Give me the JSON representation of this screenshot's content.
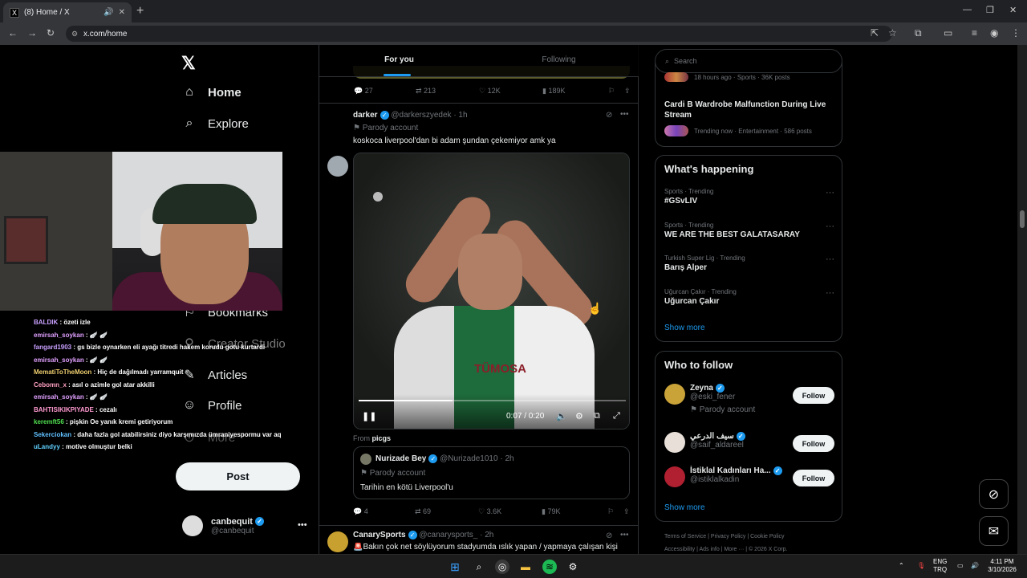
{
  "browser": {
    "tab_title": "(8) Home / X",
    "tab_favicon": "X",
    "url": "x.com/home"
  },
  "nav": {
    "home": "Home",
    "explore": "Explore",
    "bookmarks": "Bookmarks",
    "creator_studio": "Creator Studio",
    "articles": "Articles",
    "profile": "Profile",
    "more": "More",
    "post_button": "Post",
    "notif_badge": "8"
  },
  "account": {
    "name": "canbequit",
    "handle": "@canbequit"
  },
  "chat": [
    {
      "user": "BALDIK",
      "color": "#c9a0ff",
      "msg": ": özeti izle"
    },
    {
      "user": "emirsah_soykan",
      "color": "#e0a0ff",
      "msg": ": 🪽 🪽"
    },
    {
      "user": "fangard1903",
      "color": "#c9a0ff",
      "msg": ": gs bizle oynarken eli ayağı titredi hakem korudu gotu kurtardi"
    },
    {
      "user": "emirsah_soykan",
      "color": "#e0a0ff",
      "msg": ": 🪽 🪽"
    },
    {
      "user": "MematiToTheMoon",
      "color": "#f0d070",
      "msg": ": Hiç de dağılmadı yarramquit"
    },
    {
      "user": "Cebomn_x",
      "color": "#ffa0c0",
      "msg": ": asıl o azimle gol atar akkilli"
    },
    {
      "user": "emirsah_soykan",
      "color": "#e0a0ff",
      "msg": ": 🪽 🪽"
    },
    {
      "user": "BAHTISIKIKPIYADE",
      "color": "#ff9ad0",
      "msg": ": cezalı"
    },
    {
      "user": "keremft56",
      "color": "#50e050",
      "msg": ": pişkin Oe yanık kremi getiriyorum"
    },
    {
      "user": "Sekerciokan",
      "color": "#60c0ff",
      "msg": ": daha fazla gol atabilirsiniz diyo karşımızda ümraniyespormu var aq"
    },
    {
      "user": "uLandyy",
      "color": "#60d0ff",
      "msg": ": motive olmuştur belki"
    }
  ],
  "feed": {
    "tab_for_you": "For you",
    "tab_following": "Following",
    "top_stats": {
      "replies": "27",
      "reposts": "213",
      "likes": "12K",
      "views": "189K"
    },
    "tweet": {
      "name": "darker",
      "handle": "@darkerszyedek",
      "time": "· 1h",
      "parody": "Parody account",
      "text": "koskoca liverpool'dan bi adam şundan çekemiyor amk ya",
      "video_time": "0:07 / 0:20",
      "video_progress": 0.35,
      "sponsor_text": "TÜMOSA",
      "from_label": "From",
      "from_user": "picgs",
      "quote": {
        "name": "Nurizade Bey",
        "handle": "@Nurizade1010",
        "time": "· 2h",
        "parody": "Parody account",
        "text": "Tarihin en kötü Liverpool'u"
      },
      "stats": {
        "replies": "4",
        "reposts": "69",
        "likes": "3.6K",
        "views": "79K"
      }
    },
    "next_tweet": {
      "name": "CanarySports",
      "handle": "@canarysports_",
      "time": "· 2h",
      "text": "🚨Bakın çok net söylüyorum stadyumda ıslık yapan / yapmaya çalışan kişi"
    }
  },
  "right": {
    "search_placeholder": "Search",
    "partial_meta": "18 hours ago · Sports · 36K posts",
    "cardi_title": "Cardi B Wardrobe Malfunction During Live Stream",
    "cardi_meta": "Trending now · Entertainment · 586 posts",
    "whats_happening": "What's happening",
    "trends": [
      {
        "meta": "Sports · Trending",
        "name": "#GSvLIV"
      },
      {
        "meta": "Sports · Trending",
        "name": "WE ARE THE BEST GALATASARAY"
      },
      {
        "meta": "Turkish Super Lig · Trending",
        "name": "Barış Alper"
      },
      {
        "meta": "Uğurcan Çakır · Trending",
        "name": "Uğurcan Çakır"
      }
    ],
    "show_more": "Show more",
    "who_to_follow": "Who to follow",
    "follow_label": "Follow",
    "suggestions": [
      {
        "name": "Zeyna",
        "handle": "@eski_fener",
        "sub": "Parody account"
      },
      {
        "name": "سيف الدرعي",
        "handle": "@saif_aldareel",
        "sub": ""
      },
      {
        "name": "İstiklal Kadınları Ha...",
        "handle": "@istiklalkadin",
        "sub": ""
      }
    ],
    "show_more_2": "Show more",
    "footer_line1": [
      "Terms of Service",
      "Privacy Policy",
      "Cookie Policy"
    ],
    "footer_line2": [
      "Accessibility",
      "Ads info",
      "More ···",
      "© 2026 X Corp."
    ]
  },
  "taskbar": {
    "lang": "ENG",
    "region": "TRQ",
    "time": "4:11 PM",
    "date": "3/10/2026"
  }
}
